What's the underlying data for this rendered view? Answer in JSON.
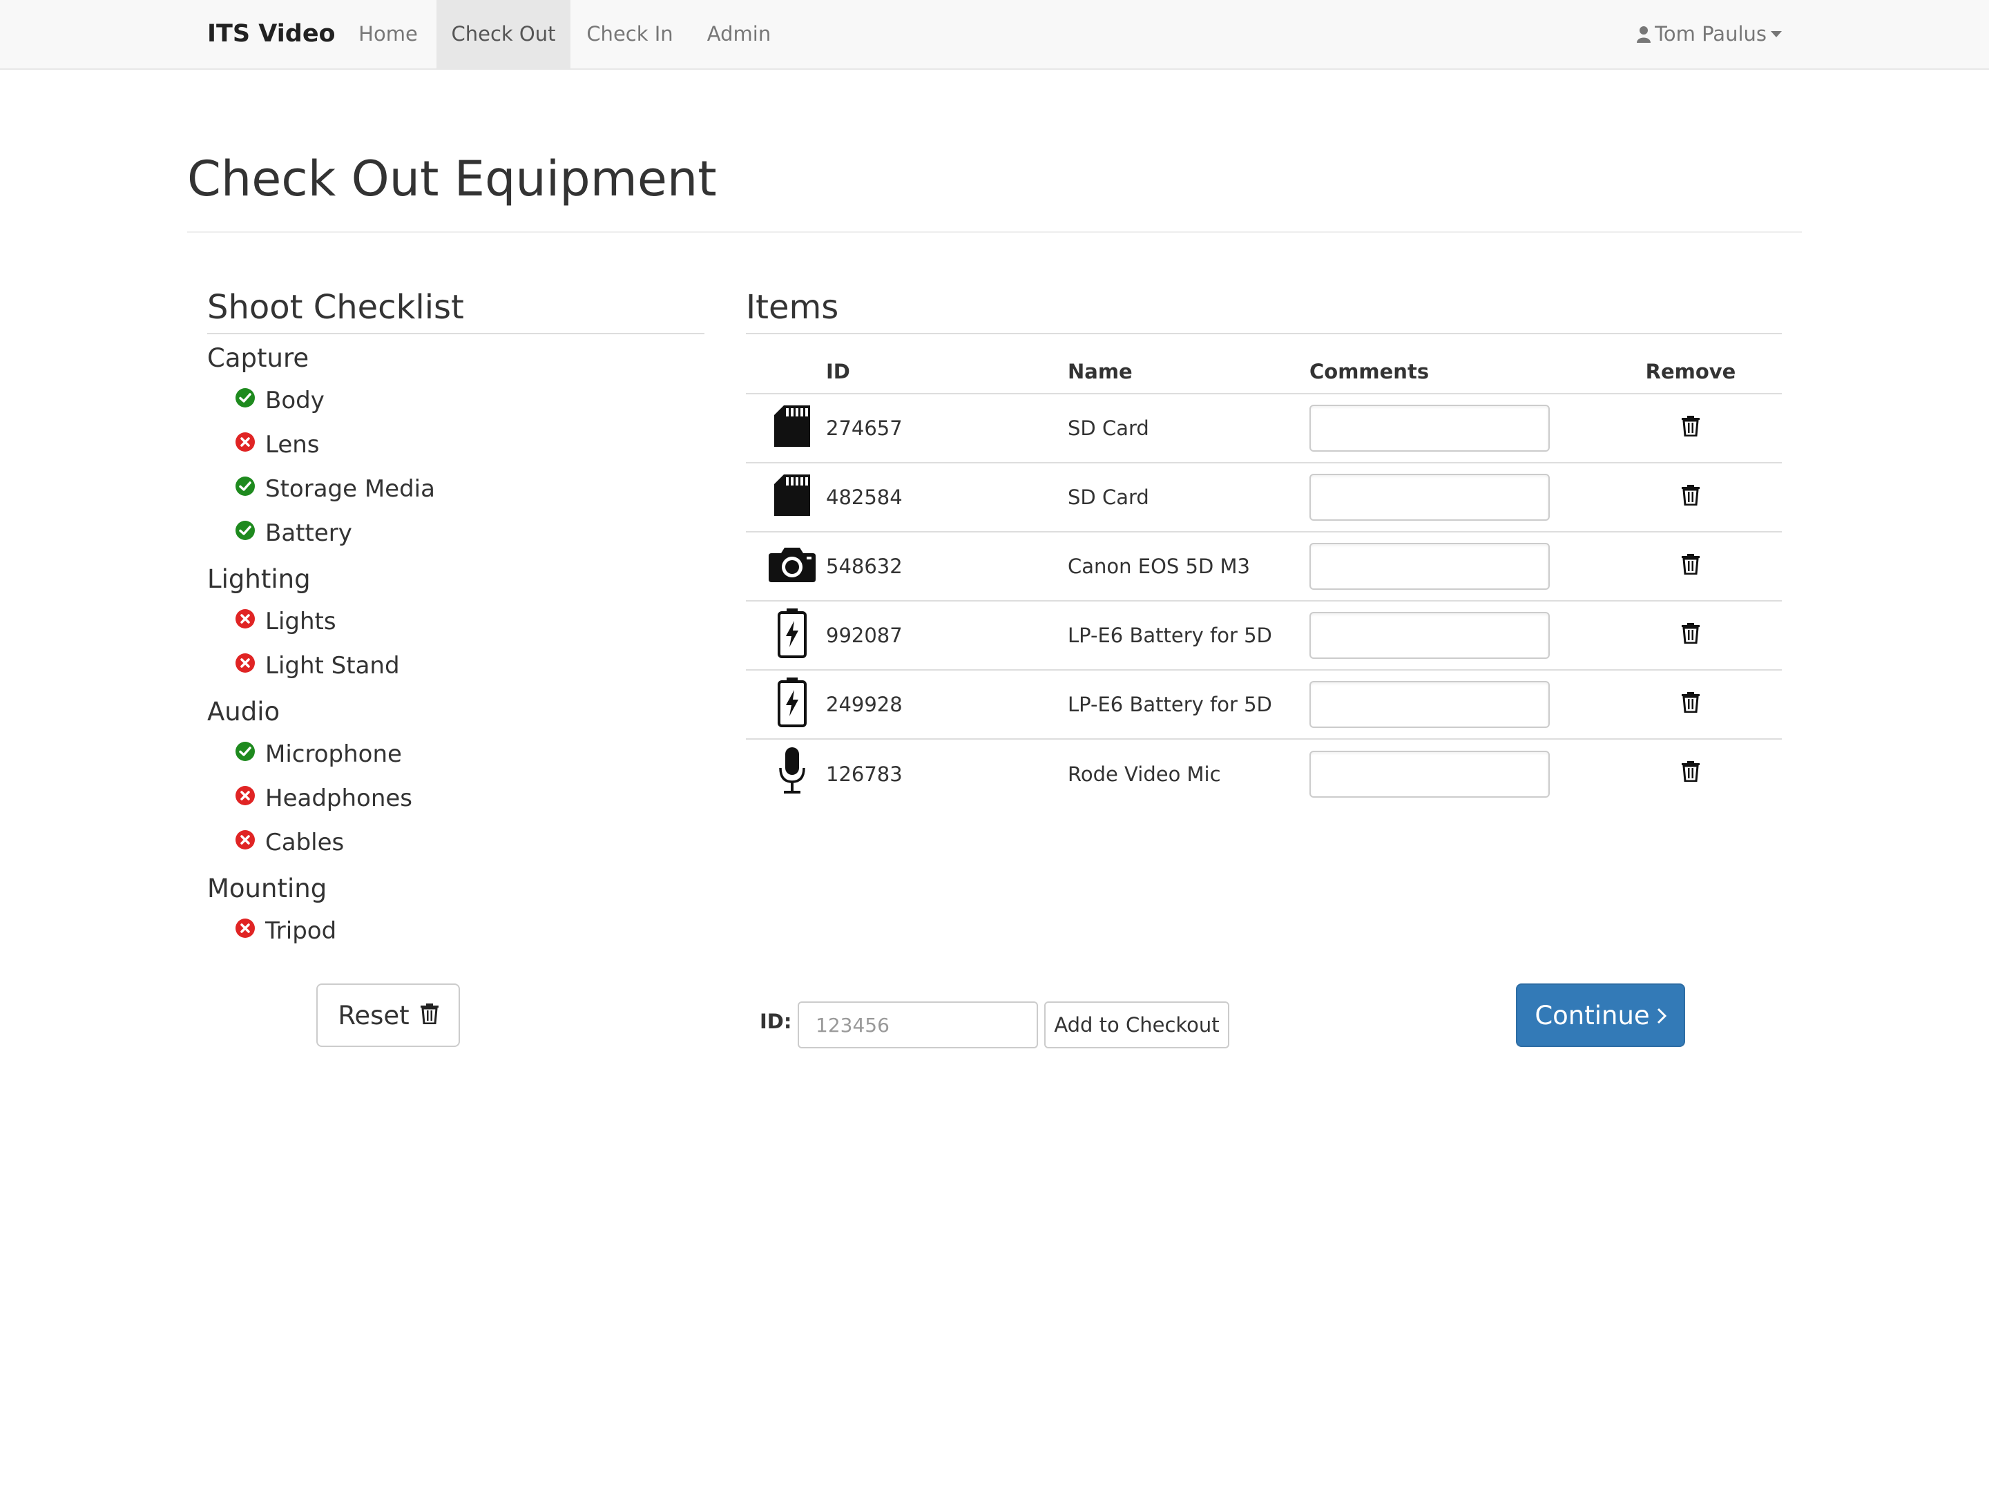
{
  "navbar": {
    "brand": "ITS Video",
    "items": [
      {
        "label": "Home",
        "active": false
      },
      {
        "label": "Check Out",
        "active": true
      },
      {
        "label": "Check In",
        "active": false
      },
      {
        "label": "Admin",
        "active": false
      }
    ],
    "user": {
      "name": "Tom Paulus",
      "icon": "user-icon",
      "caret": "caret-down-icon"
    }
  },
  "page": {
    "title": "Check Out Equipment"
  },
  "checklist": {
    "title": "Shoot Checklist",
    "groups": [
      {
        "title": "Capture",
        "items": [
          {
            "label": "Body",
            "status": "complete"
          },
          {
            "label": "Lens",
            "status": "missing"
          },
          {
            "label": "Storage Media",
            "status": "complete"
          },
          {
            "label": "Battery",
            "status": "complete"
          }
        ]
      },
      {
        "title": "Lighting",
        "items": [
          {
            "label": "Lights",
            "status": "missing"
          },
          {
            "label": "Light Stand",
            "status": "missing"
          }
        ]
      },
      {
        "title": "Audio",
        "items": [
          {
            "label": "Microphone",
            "status": "complete"
          },
          {
            "label": "Headphones",
            "status": "missing"
          },
          {
            "label": "Cables",
            "status": "missing"
          }
        ]
      },
      {
        "title": "Mounting",
        "items": [
          {
            "label": "Tripod",
            "status": "missing"
          }
        ]
      }
    ],
    "colors": {
      "complete": "#1e8a1e",
      "missing": "#e02424"
    }
  },
  "items_panel": {
    "title": "Items",
    "columns": {
      "id": "ID",
      "name": "Name",
      "comments": "Comments",
      "remove": "Remove"
    },
    "rows": [
      {
        "icon": "sd-card-icon",
        "id": "274657",
        "name": "SD Card",
        "comment": ""
      },
      {
        "icon": "sd-card-icon",
        "id": "482584",
        "name": "SD Card",
        "comment": ""
      },
      {
        "icon": "camera-icon",
        "id": "548632",
        "name": "Canon EOS 5D M3",
        "comment": ""
      },
      {
        "icon": "battery-icon",
        "id": "992087",
        "name": "LP-E6 Battery for 5D",
        "comment": ""
      },
      {
        "icon": "battery-icon",
        "id": "249928",
        "name": "LP-E6 Battery for 5D",
        "comment": ""
      },
      {
        "icon": "microphone-icon",
        "id": "126783",
        "name": "Rode Video Mic",
        "comment": ""
      }
    ]
  },
  "controls": {
    "reset_label": "Reset",
    "id_label": "ID:",
    "id_placeholder": "123456",
    "id_value": "",
    "add_label": "Add to Checkout",
    "continue_label": "Continue",
    "accent_color": "#337ab7"
  }
}
